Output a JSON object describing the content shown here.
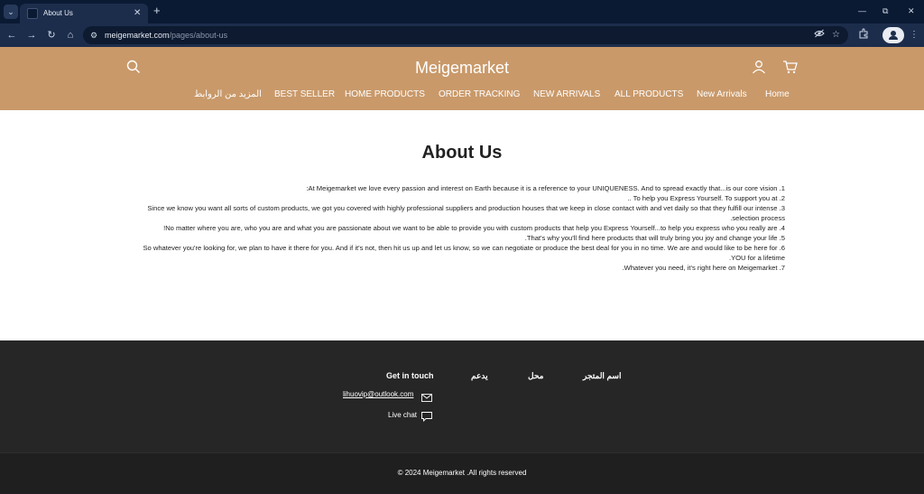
{
  "browser": {
    "tab_title": "About Us",
    "tab_close": "✕",
    "tab_new": "+",
    "tab_menu": "⌄",
    "url_host": "meigemarket.com",
    "url_path": "/pages/about-us",
    "win_min": "—",
    "win_max": "⧉",
    "win_close": "✕",
    "back": "←",
    "forward": "→",
    "reload": "↻",
    "home": "⌂",
    "site_info": "⚙",
    "star": "☆",
    "menu": "⋮"
  },
  "header": {
    "logo": "Meigemarket",
    "search_icon": "search-icon",
    "account_icon": "user-icon",
    "cart_icon": "cart-icon",
    "nav": [
      "المزيد من الروابط",
      "BEST SELLER",
      "HOME PRODUCTS",
      "ORDER TRACKING",
      "NEW ARRIVALS",
      "ALL PRODUCTS",
      "New Arrivals",
      "Home"
    ]
  },
  "main": {
    "title": "About Us",
    "paragraphs": [
      "1. At Meigemarket we love every passion and interest on Earth because it is a reference to your UNIQUENESS. And to spread exactly that...is our core vision:",
      "2. To help you Express Yourself. To support you at ..",
      "3. Since we know you want all sorts of custom products, we got you covered with highly professional suppliers and production houses that we keep in close contact with and vet daily so that they fulfill our intense selection process.",
      "4. No matter where you are, who you are and what you are passionate about we want to be able to provide you with custom products that help you Express Yourself...to help you express who you really are!",
      "5. That's why you'll find here products that will truly bring you joy and change your life.",
      "6. So whatever you're looking for, we plan to have it there for you. And if it's not, then hit us up and let us know, so we can negotiate or produce the best deal for you in no time. We are and would like to be here for YOU for a lifetime.",
      "7. Whatever you need, it's right here on Meigemarket."
    ]
  },
  "footer": {
    "col_store": "اسم المتجر",
    "col_shop": "محل",
    "col_support": "يدعم",
    "col_contact": "Get in touch",
    "email": "lihuovip@outlook.com",
    "live_chat": "Live chat",
    "copyright": "© 2024 Meigemarket .All rights reserved"
  },
  "colors": {
    "header_bg": "#c9996a",
    "footer_bg": "#262626",
    "browser_bg": "#1c2d4c"
  }
}
